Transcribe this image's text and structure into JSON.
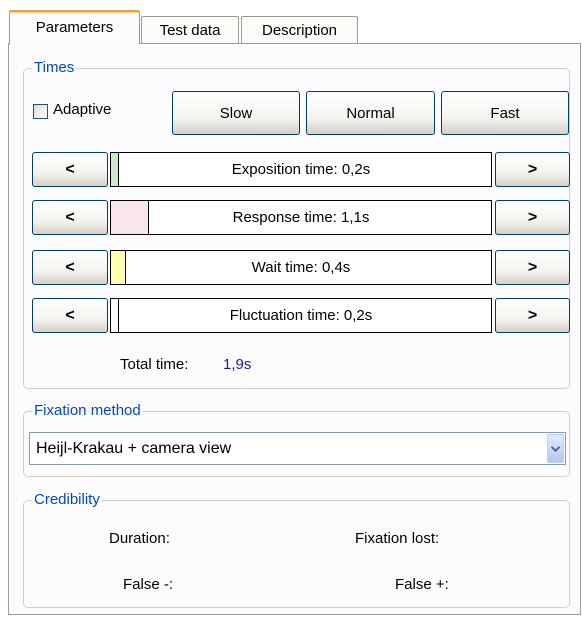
{
  "tabs": [
    {
      "label": "Parameters"
    },
    {
      "label": "Test data"
    },
    {
      "label": "Description"
    }
  ],
  "times": {
    "title": "Times",
    "adaptive": {
      "label": "Adaptive",
      "checked": false
    },
    "speed_buttons": {
      "slow": "Slow",
      "normal": "Normal",
      "fast": "Fast"
    },
    "decrease_symbol": "<",
    "increase_symbol": ">",
    "bars": [
      {
        "label": "Exposition time:  0,2s",
        "fill": 0.02,
        "color": "#cfe8cc"
      },
      {
        "label": "Response time:  1,1s",
        "fill": 0.1,
        "color": "#f8e6ec"
      },
      {
        "label": "Wait time:  0,4s",
        "fill": 0.04,
        "color": "#ffffb0"
      },
      {
        "label": "Fluctuation time:  0,2s",
        "fill": 0.02,
        "color": "#ffffff"
      }
    ],
    "total_label": "Total time:",
    "total_value": "1,9s"
  },
  "fixation": {
    "title": "Fixation method",
    "selected": "Heijl-Krakau + camera view"
  },
  "credibility": {
    "title": "Credibility",
    "duration": "Duration:",
    "fixation_lost": "Fixation lost:",
    "false_neg": "False -:",
    "false_pos": "False +:"
  },
  "colors": {
    "group_title": "#0046d5",
    "total_value": "#1a1aa6",
    "tab_highlight": "#e8a33b"
  }
}
